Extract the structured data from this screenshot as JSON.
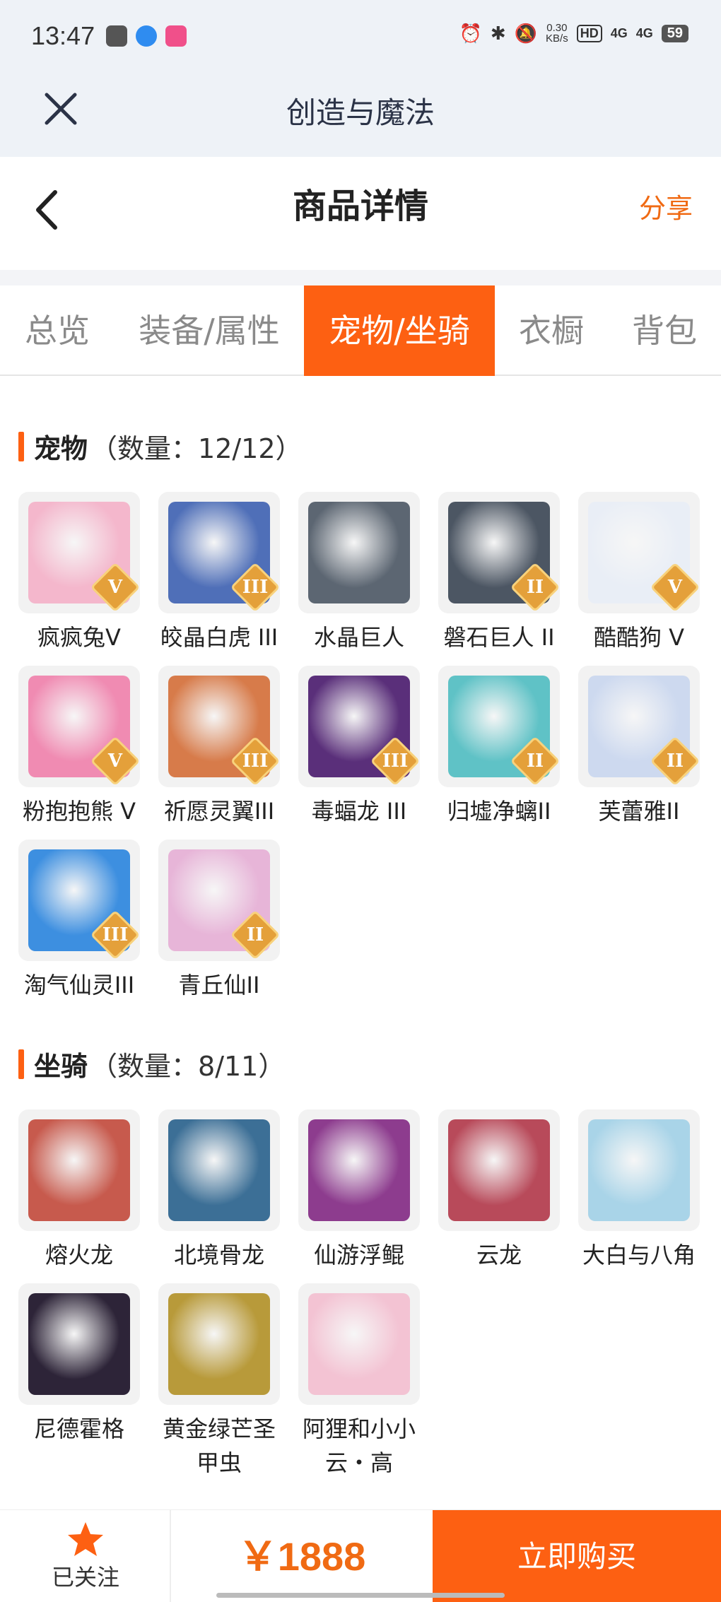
{
  "status_bar": {
    "time": "13:47",
    "speed_value": "0.30",
    "speed_unit": "KB/s",
    "hd_badge": "HD",
    "net1": "4G",
    "net2": "4G",
    "battery": "59"
  },
  "webview": {
    "title": "创造与魔法"
  },
  "page": {
    "title": "商品详情",
    "share_label": "分享"
  },
  "tabs": [
    {
      "label": "总览"
    },
    {
      "label": "装备/属性"
    },
    {
      "label": "宠物/坐骑",
      "active": true
    },
    {
      "label": "衣橱"
    },
    {
      "label": "背包"
    }
  ],
  "pets": {
    "title": "宠物",
    "count": "（数量：12/12）",
    "items": [
      {
        "name": "疯疯兔V",
        "rank": "V",
        "color": "#f4b7cc"
      },
      {
        "name": "皎晶白虎 III",
        "rank": "III",
        "color": "#4f6fb8"
      },
      {
        "name": "水晶巨人",
        "rank": "",
        "color": "#5c6672"
      },
      {
        "name": "磐石巨人 II",
        "rank": "II",
        "color": "#4c5663"
      },
      {
        "name": "酷酷狗 V",
        "rank": "V",
        "color": "#e9eef6"
      },
      {
        "name": "粉抱抱熊 V",
        "rank": "V",
        "color": "#f08bb2"
      },
      {
        "name": "祈愿灵翼III",
        "rank": "III",
        "color": "#d77b4a"
      },
      {
        "name": "毒蝠龙 III",
        "rank": "III",
        "color": "#5a2f7a"
      },
      {
        "name": "归墟净螭II",
        "rank": "II",
        "color": "#5fc2c6"
      },
      {
        "name": "芙蕾雅II",
        "rank": "II",
        "color": "#cdd9ef"
      },
      {
        "name": "淘气仙灵III",
        "rank": "III",
        "color": "#3d8fe0"
      },
      {
        "name": "青丘仙II",
        "rank": "II",
        "color": "#e7b5d8"
      }
    ]
  },
  "mounts": {
    "title": "坐骑",
    "count": "（数量：8/11）",
    "items": [
      {
        "name": "熔火龙",
        "color": "#c75a4d"
      },
      {
        "name": "北境骨龙",
        "color": "#3c6f96"
      },
      {
        "name": "仙游浮鲲",
        "color": "#8d3c8e"
      },
      {
        "name": "云龙",
        "color": "#b84a5a"
      },
      {
        "name": "大白与八角",
        "color": "#a9d4e8"
      },
      {
        "name": "尼德霍格",
        "color": "#2d2438"
      },
      {
        "name": "黄金绿芒圣甲虫",
        "color": "#b89a3a"
      },
      {
        "name": "阿狸和小小云・高",
        "color": "#f3c3d3"
      }
    ]
  },
  "bottom": {
    "follow_label": "已关注",
    "price": "￥1888",
    "buy_label": "立即购买"
  },
  "colors": {
    "accent": "#fd6012",
    "accent_text": "#f06a13"
  },
  "icons": [
    "close-icon",
    "back-chevron-icon",
    "star-icon"
  ]
}
